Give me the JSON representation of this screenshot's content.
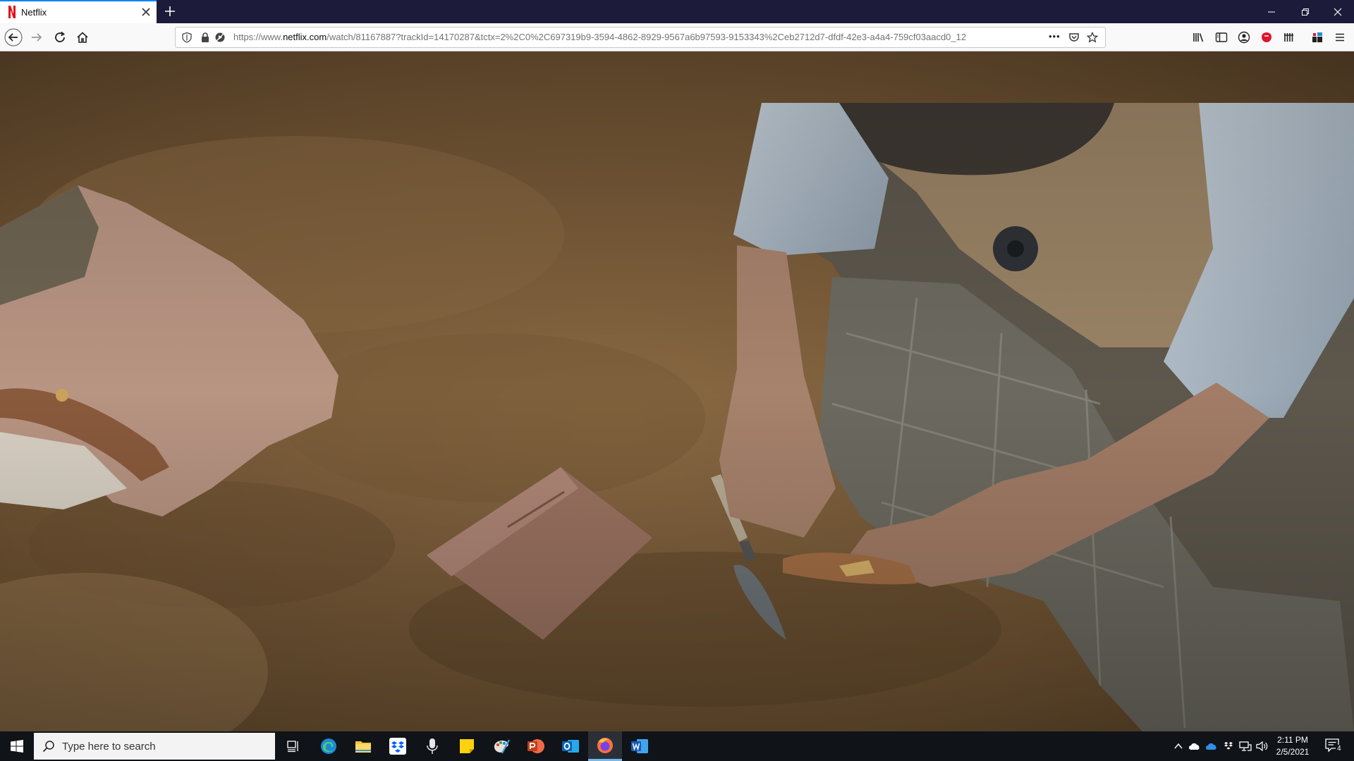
{
  "browser": {
    "tab_title": "Netflix",
    "url_prefix": "https://www.",
    "url_domain": "netflix.com",
    "url_rest": "/watch/81167887?trackId=14170287&tctx=2%2C0%2C697319b9-3594-4862-8929-9567a6b97593-9153343%2Ceb2712d7-dfdf-42e3-a4a4-759cf03aacd0_12",
    "more_label": "•••"
  },
  "taskbar": {
    "search_placeholder": "Type here to search",
    "time": "2:11 PM",
    "date": "2/5/2021",
    "notification_count": "4"
  },
  "colors": {
    "tab_accent": "#0a84ff",
    "netflix_red": "#e50914",
    "taskbar_bg": "#101318"
  }
}
